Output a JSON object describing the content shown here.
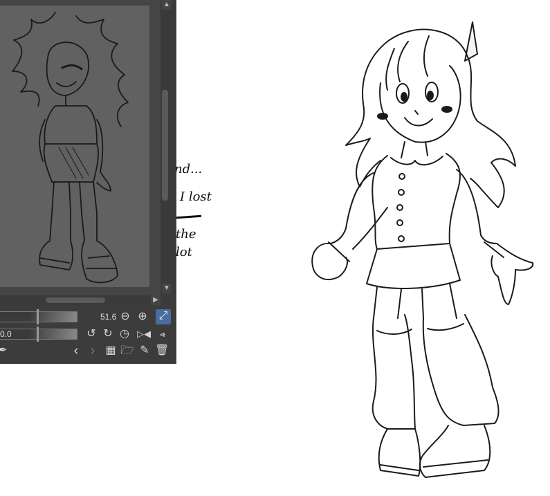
{
  "navigator": {
    "zoom_value": "51.6",
    "rotation_value": "0.0",
    "icons": {
      "zoom_out": "zoom-out-icon",
      "zoom_in": "zoom-in-icon",
      "fit": "fit-to-window-icon",
      "rotate_left": "rotate-left-icon",
      "rotate_right": "rotate-right-icon",
      "reset_rotation": "reset-rotation-icon",
      "flip_horizontal": "flip-horizontal-icon",
      "flip_vertical": "flip-vertical-icon",
      "eyedropper": "eyedropper-icon",
      "previous": "chevron-left-icon",
      "next": "chevron-right-icon",
      "grid": "grid-view-icon",
      "open": "open-folder-icon",
      "edit": "edit-icon",
      "delete": "trash-icon"
    }
  },
  "notes": {
    "lines": [
      "nd...",
      "I lost",
      "the",
      "lot"
    ]
  },
  "colors": {
    "panel": "#3c3c3c",
    "preview_bg": "#616161",
    "active_button": "#4a6d9c"
  }
}
